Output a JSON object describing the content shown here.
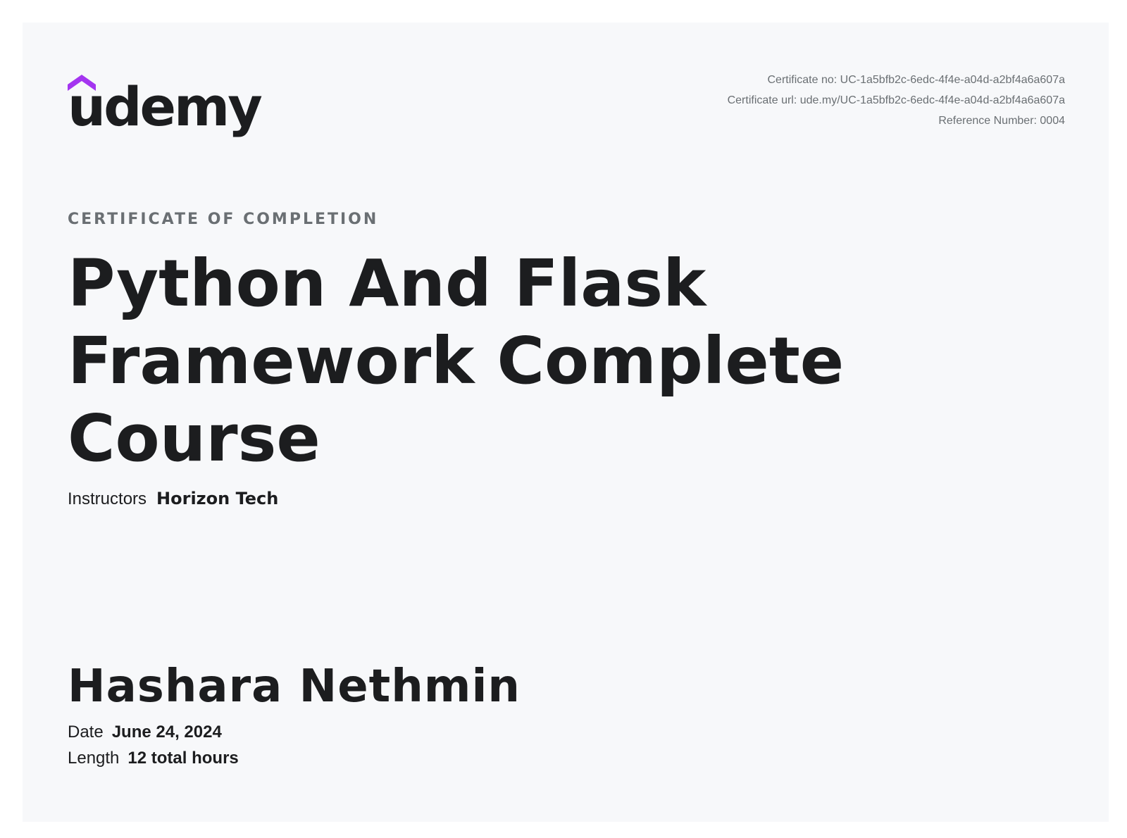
{
  "brand": {
    "name": "udemy",
    "accent_color": "#a435f0",
    "text_color": "#1c1d1f"
  },
  "meta": {
    "certificate_no": "Certificate no: UC-1a5bfb2c-6edc-4f4e-a04d-a2bf4a6a607a",
    "certificate_url": "Certificate url: ude.my/UC-1a5bfb2c-6edc-4f4e-a04d-a2bf4a6a607a",
    "reference_number": "Reference Number: 0004"
  },
  "eyebrow": "CERTIFICATE OF COMPLETION",
  "course_title": "Python And Flask Framework Complete Course",
  "instructors": {
    "label": "Instructors",
    "value": "Horizon Tech"
  },
  "recipient": "Hashara Nethmin",
  "date": {
    "label": "Date",
    "value": "June 24, 2024"
  },
  "length": {
    "label": "Length",
    "value": "12 total hours"
  }
}
